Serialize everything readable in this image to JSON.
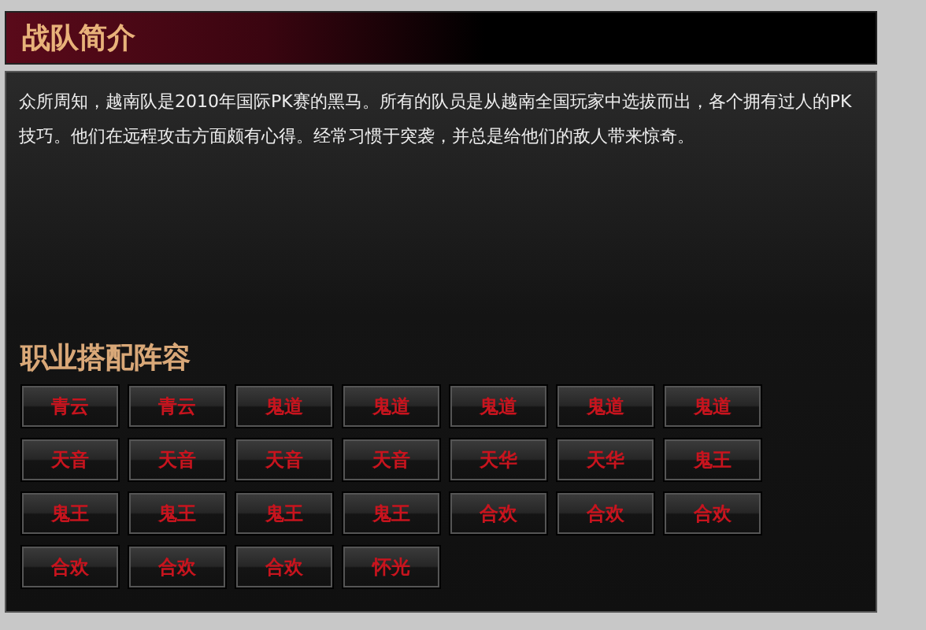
{
  "header": {
    "title": "战队简介"
  },
  "intro": "众所周知，越南队是2010年国际PK赛的黑马。所有的队员是从越南全国玩家中选拔而出，各个拥有过人的PK技巧。他们在远程攻击方面颇有心得。经常习惯于突袭，并总是给他们的敌人带来惊奇。",
  "lineup": {
    "title": "职业搭配阵容",
    "roles": [
      "青云",
      "青云",
      "鬼道",
      "鬼道",
      "鬼道",
      "鬼道",
      "鬼道",
      "天音",
      "天音",
      "天音",
      "天音",
      "天华",
      "天华",
      "鬼王",
      "鬼王",
      "鬼王",
      "鬼王",
      "鬼王",
      "合欢",
      "合欢",
      "合欢",
      "合欢",
      "合欢",
      "合欢",
      "怀光"
    ]
  }
}
